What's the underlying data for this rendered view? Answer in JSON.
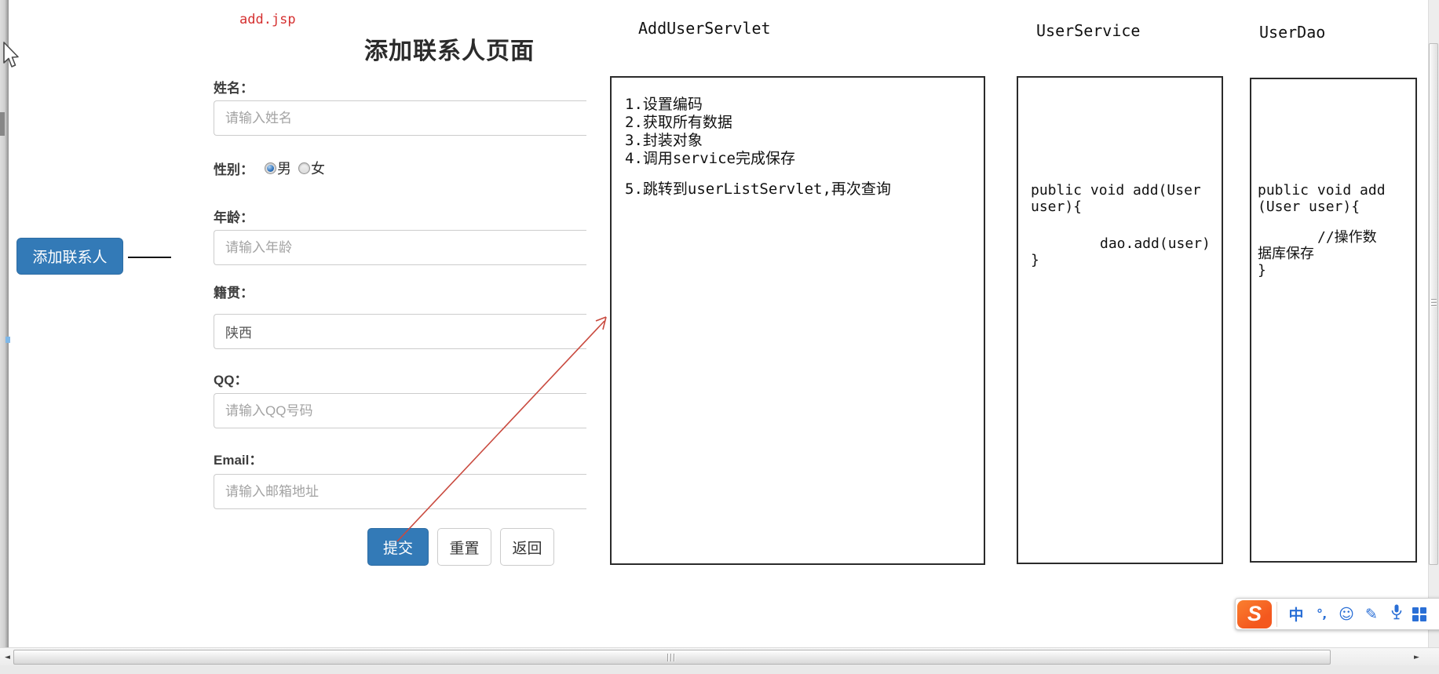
{
  "colors": {
    "primary_blue": "#337ab7",
    "primary_blue_border": "#2e6da4",
    "annotation_red": "#d53030",
    "arrow_red": "#c94a3f",
    "ime_icon_blue": "#2a6fd6",
    "sogou_orange": "#f4581e"
  },
  "jsp_label": "add.jsp",
  "form": {
    "title": "添加联系人页面",
    "name_label": "姓名：",
    "name_placeholder": "请输入姓名",
    "gender_label": "性别：",
    "gender_male": "男",
    "gender_female": "女",
    "age_label": "年龄：",
    "age_placeholder": "请输入年龄",
    "native_label": "籍贯：",
    "native_value": "陕西",
    "qq_label": "QQ：",
    "qq_placeholder": "请输入QQ号码",
    "email_label": "Email：",
    "email_placeholder": "请输入邮箱地址",
    "submit_label": "提交",
    "reset_label": "重置",
    "back_label": "返回"
  },
  "add_contact_button": "添加联系人",
  "servlet_box": {
    "title": "AddUserServlet",
    "steps": [
      "1.设置编码",
      "2.获取所有数据",
      "3.封装对象",
      "4.调用service完成保存",
      "5.跳转到userListServlet,再次查询"
    ]
  },
  "service_box": {
    "title": "UserService",
    "lines": [
      "public void add(User",
      "user){",
      "dao.add(user)",
      "}"
    ]
  },
  "dao_box": {
    "title": "UserDao",
    "lines": [
      "public void add",
      "(User user){",
      "//操作数",
      "据库保存",
      "}"
    ]
  },
  "ime": {
    "logo_letter": "S",
    "zh_toggle": "中",
    "punct_icon": "°‚",
    "emoji_icon": "☺",
    "pen_icon": "✎"
  },
  "scrollbar": {
    "left_arrow": "◄",
    "right_arrow": "►"
  }
}
